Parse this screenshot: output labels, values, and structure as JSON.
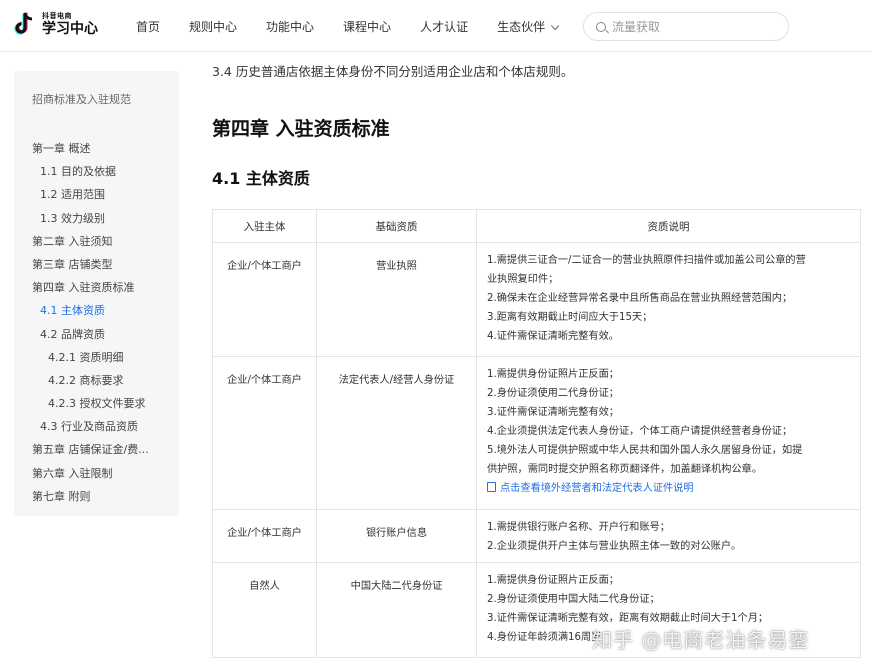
{
  "header": {
    "logo_small": "抖音电商",
    "logo_big": "学习中心",
    "nav": [
      "首页",
      "规则中心",
      "功能中心",
      "课程中心",
      "人才认证",
      "生态伙伴"
    ],
    "search_placeholder": "流量获取"
  },
  "sidebar": {
    "title": "招商标准及入驻规范",
    "items": [
      {
        "label": "第一章 概述",
        "level": 1
      },
      {
        "label": "1.1 目的及依据",
        "level": 2
      },
      {
        "label": "1.2 适用范围",
        "level": 2
      },
      {
        "label": "1.3 效力级别",
        "level": 2
      },
      {
        "label": "第二章 入驻须知",
        "level": 1
      },
      {
        "label": "第三章 店铺类型",
        "level": 1
      },
      {
        "label": "第四章 入驻资质标准",
        "level": 1
      },
      {
        "label": "4.1 主体资质",
        "level": 2,
        "active": true
      },
      {
        "label": "4.2 品牌资质",
        "level": 2
      },
      {
        "label": "4.2.1 资质明细",
        "level": 3
      },
      {
        "label": "4.2.2 商标要求",
        "level": 3
      },
      {
        "label": "4.2.3 授权文件要求",
        "level": 3
      },
      {
        "label": "4.3 行业及商品资质",
        "level": 2
      },
      {
        "label": "第五章 店铺保证金/费...",
        "level": 1
      },
      {
        "label": "第六章 入驻限制",
        "level": 1
      },
      {
        "label": "第七章 附则",
        "level": 1
      }
    ]
  },
  "main": {
    "intro": "3.4 历史普通店依据主体身份不同分别适用企业店和个体店规则。",
    "chapter_title": "第四章 入驻资质标准",
    "section_title": "4.1 主体资质",
    "table": {
      "headers": [
        "入驻主体",
        "基础资质",
        "资质说明"
      ],
      "rows": [
        {
          "subject": "企业/个体工商户",
          "basic": "营业执照",
          "lines": [
            "1.需提供三证合一/二证合一的营业执照原件扫描件或加盖公司公章的营",
            "业执照复印件；",
            "2.确保未在企业经营异常名录中且所售商品在营业执照经营范围内；",
            "3.距离有效期截止时间应大于15天；",
            "4.证件需保证清晰完整有效。"
          ]
        },
        {
          "subject": "企业/个体工商户",
          "basic": "法定代表人/经营人身份证",
          "lines": [
            "1.需提供身份证照片正反面；",
            "2.身份证须使用二代身份证；",
            "3.证件需保证清晰完整有效；",
            "4.企业须提供法定代表人身份证，个体工商户请提供经营者身份证；",
            "5.境外法人可提供护照或中华人民共和国外国人永久居留身份证，如提",
            "供护照，需同时提交护照名称页翻译件，加盖翻译机构公章。"
          ],
          "link": "点击查看境外经营者和法定代表人证件说明"
        },
        {
          "subject": "企业/个体工商户",
          "basic": "银行账户信息",
          "lines": [
            "1.需提供银行账户名称、开户行和账号；",
            "2.企业须提供开户主体与营业执照主体一致的对公账户。"
          ]
        },
        {
          "subject": "自然人",
          "basic": "中国大陆二代身份证",
          "lines": [
            "1.需提供身份证照片正反面；",
            "2.身份证须使用中国大陆二代身份证；",
            "3.证件需保证清晰完整有效，距离有效期截止时间大于1个月；",
            "4.身份证年龄须满16周岁"
          ]
        }
      ]
    }
  },
  "watermark": "知乎 @电商老油条易銮"
}
